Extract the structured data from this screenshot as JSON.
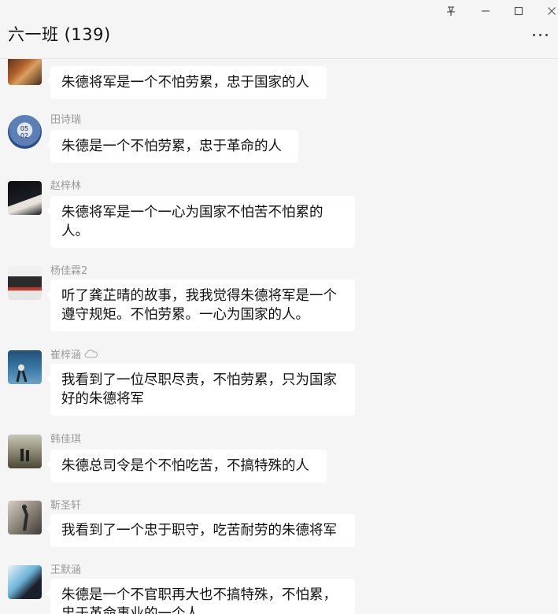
{
  "window": {
    "pin_icon": "pin-icon",
    "minimize_icon": "minimize-icon",
    "maximize_icon": "maximize-icon",
    "close_icon": "close-icon"
  },
  "chat": {
    "title": "六一班 (139)",
    "more_icon": "more-options-icon"
  },
  "messages": [
    {
      "sender": "",
      "text": "朱德将军是一个不怕劳累，忠于国家的人",
      "avatar_icon": "avatar-warrior"
    },
    {
      "sender": "田诗瑞",
      "text": "朱德是一个不怕劳累，忠于革命的人",
      "avatar_icon": "avatar-clock"
    },
    {
      "sender": "赵梓林",
      "text": "朱德将军是一个一心为国家不怕苦不怕累的人。",
      "avatar_icon": "avatar-anime"
    },
    {
      "sender": "杨佳霖2",
      "text": "听了龚芷晴的故事，我我觉得朱德将军是一个遵守规矩。不怕劳累。一心为国家的人。",
      "avatar_icon": "avatar-car"
    },
    {
      "sender": "崔梓涵",
      "text": "我看到了一位尽职尽责，不怕劳累，只为国家好的朱德将军",
      "avatar_icon": "avatar-sky",
      "badge_icon": "cloud-icon"
    },
    {
      "sender": "韩佳琪",
      "text": "朱德总司令是个不怕吃苦，不搞特殊的人",
      "avatar_icon": "avatar-walkers"
    },
    {
      "sender": "靳圣轩",
      "text": "我看到了一个忠于职守，吃苦耐劳的朱德将军",
      "avatar_icon": "avatar-soldier"
    },
    {
      "sender": "王默涵",
      "text": "朱德是一个不官职再大也不搞特殊，不怕累，忠于革命事业的一个人",
      "avatar_icon": "avatar-swordsman"
    }
  ],
  "colors": {
    "background": "#f5f5f5",
    "bubble": "#ffffff",
    "sender": "#999999",
    "text": "#111111"
  }
}
